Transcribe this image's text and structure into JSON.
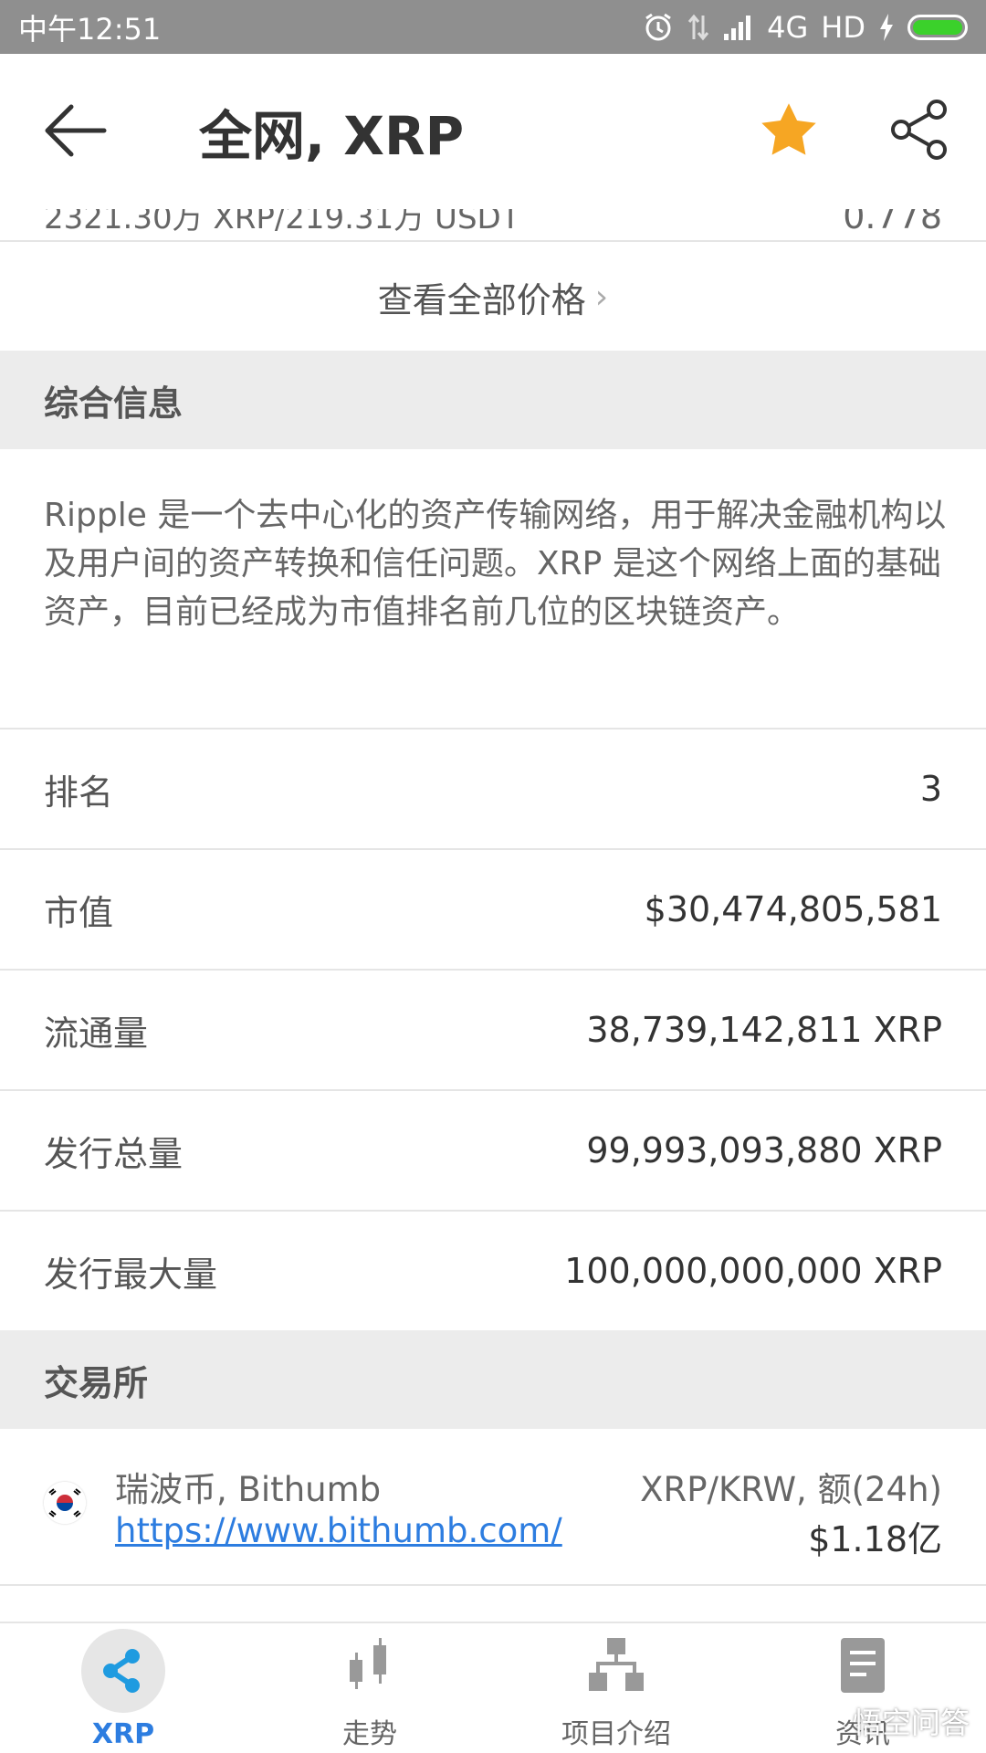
{
  "status": {
    "time": "中午12:51",
    "network": "4G",
    "hd": "HD"
  },
  "header": {
    "title": "全网, XRP"
  },
  "partial_row": {
    "left": "2321.30万 XRP/219.31万 USDT",
    "right": "0.778"
  },
  "view_all": {
    "label": "查看全部价格"
  },
  "overview": {
    "heading": "综合信息",
    "description": "Ripple 是一个去中心化的资产传输网络，用于解决金融机构以及用户间的资产转换和信任问题。XRP 是这个网络上面的基础资产，目前已经成为市值排名前几位的区块链资产。",
    "rows": [
      {
        "key": "排名",
        "value": "3"
      },
      {
        "key": "市值",
        "value": "$30,474,805,581"
      },
      {
        "key": "流通量",
        "value": "38,739,142,811 XRP"
      },
      {
        "key": "发行总量",
        "value": "99,993,093,880 XRP"
      },
      {
        "key": "发行最大量",
        "value": "100,000,000,000 XRP"
      }
    ]
  },
  "exchanges": {
    "heading": "交易所",
    "items": [
      {
        "name": "瑞波币, Bithumb",
        "url": "https://www.bithumb.com/",
        "pair": "XRP/KRW, 额(24h)",
        "volume": "$1.18亿"
      }
    ]
  },
  "nav": {
    "tabs": [
      {
        "label": "XRP",
        "icon": "xrp-logo-icon",
        "active": true
      },
      {
        "label": "走势",
        "icon": "candlestick-icon"
      },
      {
        "label": "项目介绍",
        "icon": "hierarchy-icon"
      },
      {
        "label": "资讯",
        "icon": "document-icon"
      }
    ]
  },
  "watermark": "悟空问答",
  "colors": {
    "accent": "#2d7de0",
    "star": "#f6a623",
    "status_bar": "#8f8f8f",
    "section_bg": "#ececec"
  }
}
